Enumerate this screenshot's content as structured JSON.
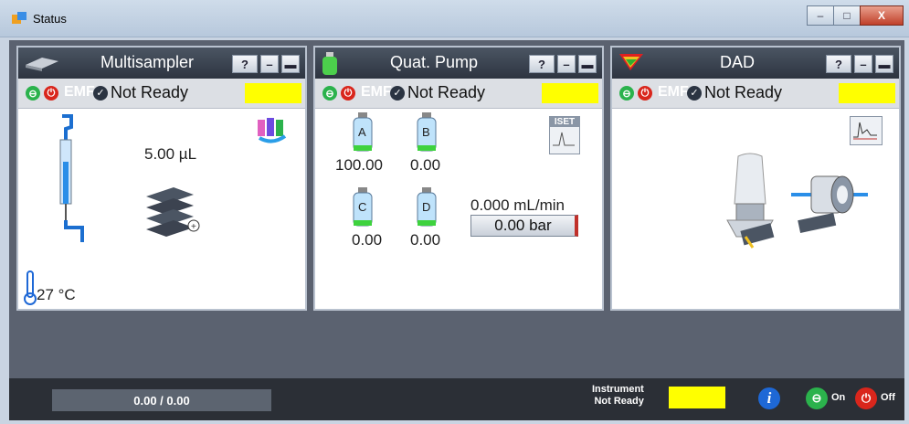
{
  "window": {
    "title": "Status",
    "controls": {
      "minimize": "–",
      "maximize": "□",
      "close": "X"
    }
  },
  "panels": {
    "multisampler": {
      "title": "Multisampler",
      "help": "?",
      "emf": "EMF",
      "status": "Not Ready",
      "volume": "5.00 µL",
      "temperature": "27 °C"
    },
    "pump": {
      "title": "Quat. Pump",
      "help": "?",
      "emf": "EMF",
      "status": "Not Ready",
      "bottles": [
        {
          "label": "A",
          "value": "100.00"
        },
        {
          "label": "B",
          "value": "0.00"
        },
        {
          "label": "C",
          "value": "0.00"
        },
        {
          "label": "D",
          "value": "0.00"
        }
      ],
      "flow": "0.000 mL/min",
      "pressure": "0.00 bar",
      "iset": "ISET"
    },
    "dad": {
      "title": "DAD",
      "help": "?",
      "emf": "EMF",
      "status": "Not Ready"
    }
  },
  "footer": {
    "progress": "0.00 / 0.00",
    "instrument_line1": "Instrument",
    "instrument_line2": "Not Ready",
    "on_label": "On",
    "off_label": "Off"
  },
  "colors": {
    "ready_indicator": "#ffff00",
    "on": "#2bb24c",
    "off": "#d9261c",
    "info": "#1e68d6"
  },
  "icons": [
    "status-app-icon",
    "multisampler-icon",
    "pump-bottle-icon",
    "dad-rainbow-icon",
    "vials-icon",
    "iset-icon",
    "spectrum-icon",
    "thermometer-icon",
    "info-icon"
  ]
}
